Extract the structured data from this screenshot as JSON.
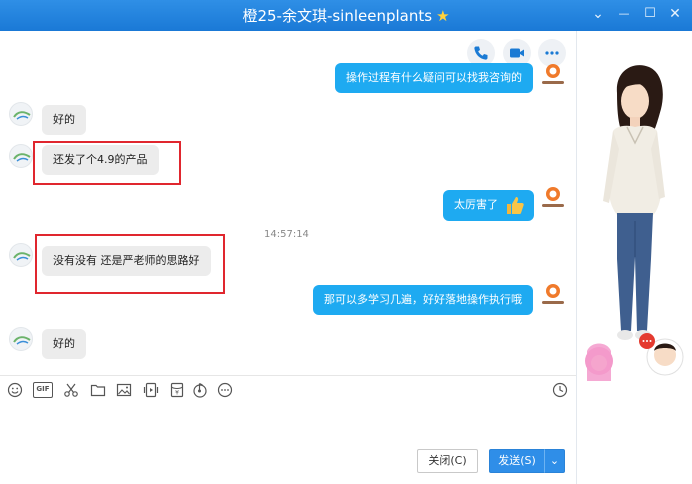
{
  "window": {
    "title": "橙25-余文琪-sinleenplants",
    "title_star": "★",
    "controls": {
      "minimize": "—",
      "maximize": "☐",
      "close": "✕",
      "menu": "⌄"
    }
  },
  "chat": {
    "time_stamp": "14:57:14",
    "messages": [
      {
        "side": "right",
        "text": "操作过程有什么疑问可以找我咨询的"
      },
      {
        "side": "left",
        "text": "好的"
      },
      {
        "side": "left",
        "text": "还发了个4.9的产品",
        "highlighted": true
      },
      {
        "side": "right",
        "text": "太厉害了",
        "emoji": "thumbs-up"
      },
      {
        "side": "left",
        "text": "没有没有 还是严老师的思路好",
        "highlighted": true
      },
      {
        "side": "right",
        "text": "那可以多学习几遍，好好落地操作执行哦"
      },
      {
        "side": "left",
        "text": "好的"
      }
    ]
  },
  "toolbar": {
    "gif_label": "GIF",
    "icons": [
      "smiley-icon",
      "gif-icon",
      "scissors-icon",
      "folder-icon",
      "image-icon",
      "video-icon",
      "red-packet-icon",
      "music-icon",
      "more-icon"
    ]
  },
  "buttons": {
    "close_label": "关闭(C)",
    "send_label": "发送(S)",
    "send_dropdown": "⌄"
  },
  "colors": {
    "accent": "#1a79d6",
    "bubble_right": "#1eaaf1",
    "bubble_left": "#ececec",
    "highlight": "#e0262e"
  }
}
